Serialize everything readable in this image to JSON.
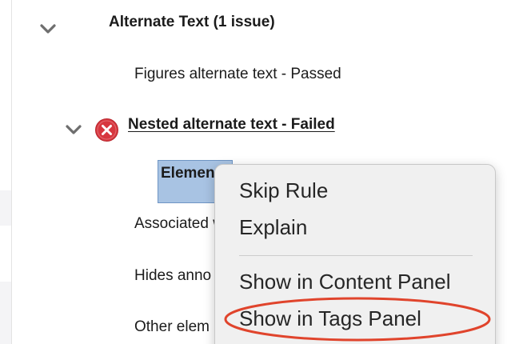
{
  "tree": {
    "group": {
      "label": "Alternate Text (1 issue)",
      "expanded_icon": "chevron-down-icon"
    },
    "rules": [
      {
        "label": "Figures alternate text - Passed",
        "status": "passed"
      },
      {
        "label": "Nested alternate text - Failed",
        "status": "failed",
        "status_icon": "error-icon",
        "status_color": "#d7373f",
        "expanded_icon": "chevron-down-icon",
        "children": [
          {
            "label": "Element",
            "selected": true
          }
        ]
      },
      {
        "label": "Associated w",
        "status": ""
      },
      {
        "label": "Hides anno",
        "status": ""
      },
      {
        "label": "Other elem",
        "status": ""
      }
    ]
  },
  "context_menu": {
    "items": [
      {
        "label": "Skip Rule"
      },
      {
        "label": "Explain"
      },
      {
        "label": "Show in Content Panel"
      },
      {
        "label": "Show in Tags Panel",
        "annotated": true
      }
    ],
    "annotation_color": "#e0442c"
  },
  "colors": {
    "selection_fill": "#a8c3e3",
    "menu_background": "#f0f0f0"
  }
}
